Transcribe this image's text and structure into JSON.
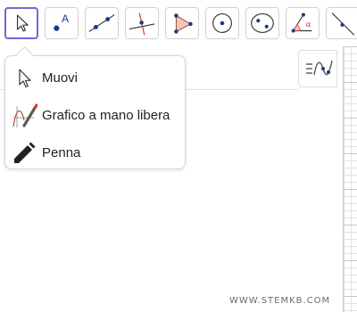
{
  "toolbar": {
    "tools": [
      {
        "name": "move-tool",
        "icon": "arrow-cursor-icon",
        "selected": true
      },
      {
        "name": "point-tool",
        "icon": "point-a-icon",
        "selected": false
      },
      {
        "name": "line-tool",
        "icon": "line-through-points-icon",
        "selected": false
      },
      {
        "name": "perpendicular-line-tool",
        "icon": "perpendicular-line-icon",
        "selected": false
      },
      {
        "name": "polygon-tool",
        "icon": "triangle-polygon-icon",
        "selected": false
      },
      {
        "name": "circle-center-point-tool",
        "icon": "circle-center-icon",
        "selected": false
      },
      {
        "name": "conic-tool",
        "icon": "ellipse-icon",
        "selected": false
      },
      {
        "name": "angle-tool",
        "icon": "angle-alpha-icon",
        "selected": false
      },
      {
        "name": "reflect-tool",
        "icon": "reflect-line-icon",
        "selected": false
      }
    ],
    "accent_color": "#6f6bd1"
  },
  "popup_menu": {
    "items": [
      {
        "label": "Muovi",
        "icon": "arrow-cursor-icon"
      },
      {
        "label": "Grafico a mano libera",
        "icon": "freehand-graph-icon"
      },
      {
        "label": "Penna",
        "icon": "pen-icon"
      }
    ]
  },
  "graphics": {
    "style_bar_icon": "style-bar-graph-icon",
    "watermark": "WWW.STEMKB.COM"
  }
}
